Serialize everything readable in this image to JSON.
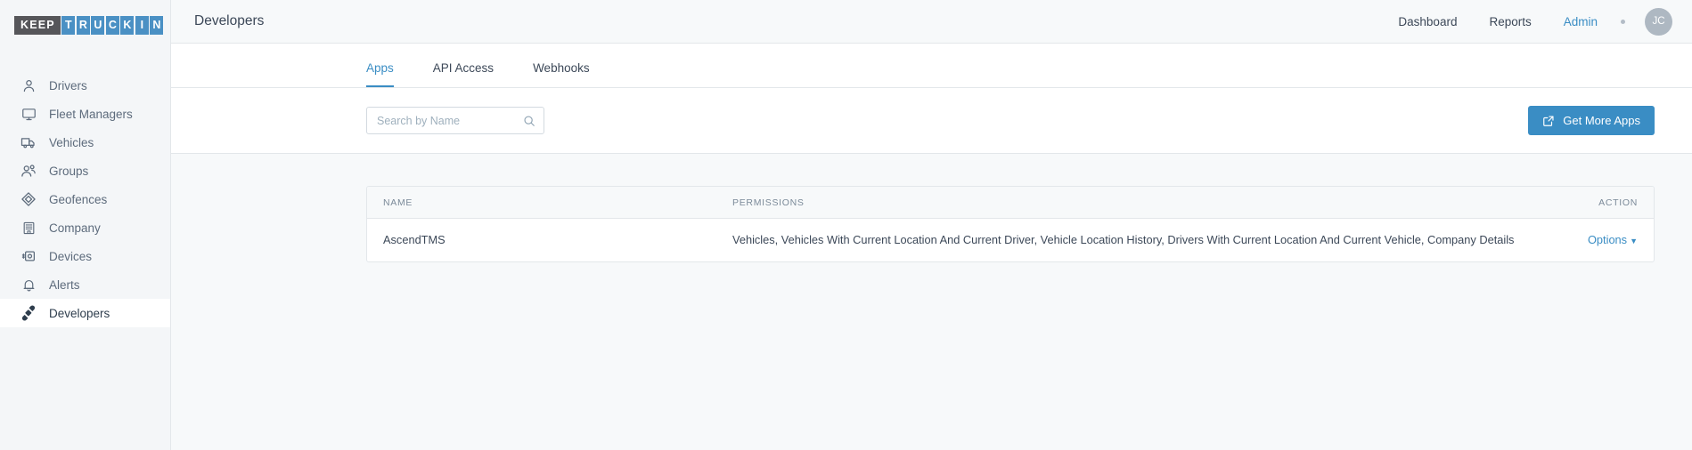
{
  "brand": {
    "logo_keep": "KEEP",
    "logo_tiles": [
      "T",
      "R",
      "U",
      "C",
      "K",
      "I",
      "N"
    ],
    "color_dark": "#56565a",
    "color_blue": "#4a90c4"
  },
  "sidebar": {
    "items": [
      {
        "label": "Drivers",
        "icon": "user-icon",
        "active": false
      },
      {
        "label": "Fleet Managers",
        "icon": "monitor-icon",
        "active": false
      },
      {
        "label": "Vehicles",
        "icon": "truck-icon",
        "active": false
      },
      {
        "label": "Groups",
        "icon": "users-icon",
        "active": false
      },
      {
        "label": "Geofences",
        "icon": "geofence-icon",
        "active": false
      },
      {
        "label": "Company",
        "icon": "building-icon",
        "active": false
      },
      {
        "label": "Devices",
        "icon": "device-icon",
        "active": false
      },
      {
        "label": "Alerts",
        "icon": "bell-icon",
        "active": false
      },
      {
        "label": "Developers",
        "icon": "plugin-icon",
        "active": true
      }
    ]
  },
  "header": {
    "title": "Developers",
    "nav": [
      {
        "label": "Dashboard",
        "active": false
      },
      {
        "label": "Reports",
        "active": false
      },
      {
        "label": "Admin",
        "active": true
      }
    ],
    "avatar_initials": "JC",
    "accent_color": "#3a8dc4"
  },
  "tabs": [
    {
      "label": "Apps",
      "active": true
    },
    {
      "label": "API Access",
      "active": false
    },
    {
      "label": "Webhooks",
      "active": false
    }
  ],
  "toolbar": {
    "search": {
      "value": "",
      "placeholder": "Search by Name"
    },
    "get_more_apps_label": "Get More Apps"
  },
  "table": {
    "columns": [
      "NAME",
      "PERMISSIONS",
      "ACTION"
    ],
    "rows": [
      {
        "name": "AscendTMS",
        "permissions": "Vehicles, Vehicles With Current Location And Current Driver, Vehicle Location History, Drivers With Current Location And Current Vehicle, Company Details",
        "action_label": "Options",
        "action_caret": "▼"
      }
    ]
  }
}
